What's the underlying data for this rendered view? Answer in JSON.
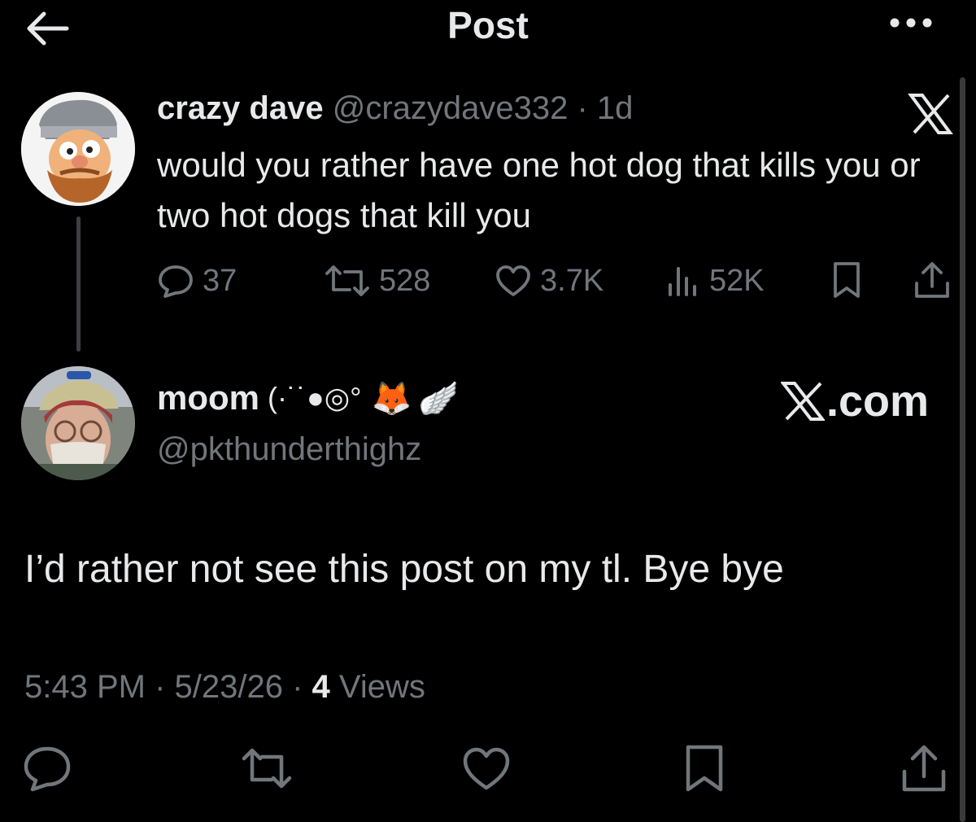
{
  "header": {
    "title": "Post"
  },
  "parent_post": {
    "author_name": "crazy dave",
    "handle": "@crazydave332",
    "time": "1d",
    "text": "would you rather have one hot dog that kills you or two hot dogs that kill you",
    "stats": {
      "replies": "37",
      "reposts": "528",
      "likes": "3.7K",
      "views": "52K"
    }
  },
  "reply": {
    "author_name": "moom",
    "name_kaomoji": "(·˙˙●◎°",
    "name_emojis": [
      "🦊",
      "🪽"
    ],
    "handle": "@pkthunderthighz",
    "text": "I’d rather not see this post on my tl. Bye bye",
    "time": "5:43 PM",
    "date": "5/23/26",
    "views_count": "4",
    "views_label": "Views"
  },
  "watermark": {
    "text": ".com"
  },
  "colors": {
    "background": "#000000",
    "text": "#e7e9ea",
    "muted": "#71767b"
  }
}
